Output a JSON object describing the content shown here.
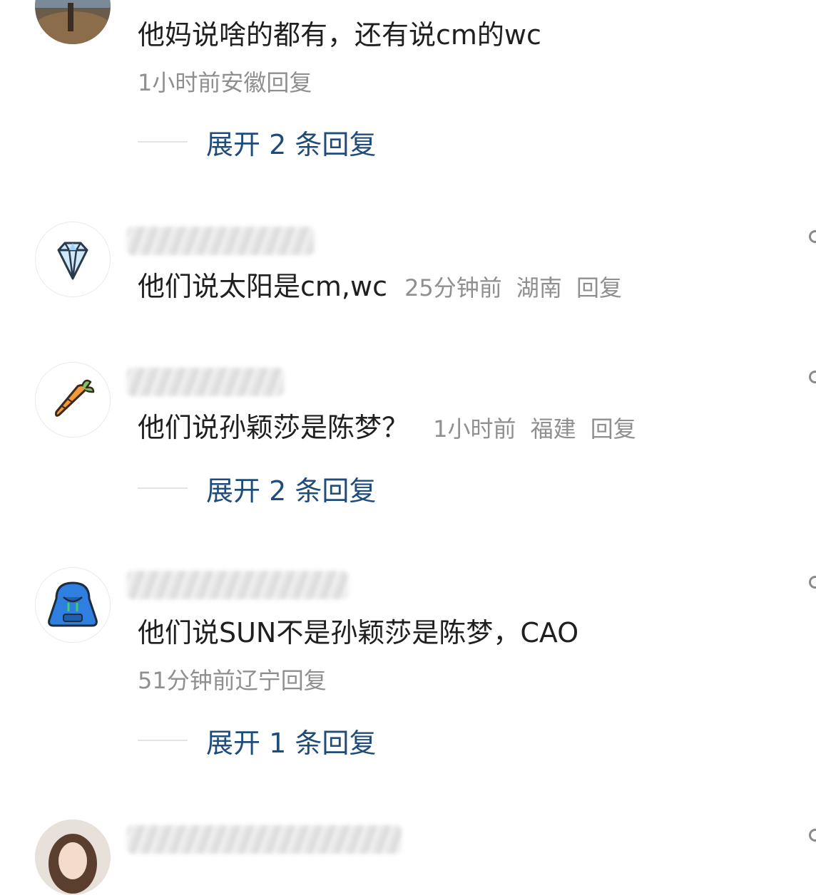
{
  "comments": [
    {
      "text": "他妈说啥的都有，还有说cm的wc",
      "time": "1小时前",
      "region": "安徽",
      "reply_label": "回复",
      "expand_label": "展开 2 条回复"
    },
    {
      "text": "他们说太阳是cm,wc",
      "time": "25分钟前",
      "region": "湖南",
      "reply_label": "回复"
    },
    {
      "text": "他们说孙颖莎是陈梦？",
      "time": "1小时前",
      "region": "福建",
      "reply_label": "回复",
      "expand_label": "展开 2 条回复"
    },
    {
      "text": "他们说SUN不是孙颖莎是陈梦，CAO",
      "time": "51分钟前",
      "region": "辽宁",
      "reply_label": "回复",
      "expand_label": "展开 1 条回复"
    }
  ],
  "icons": {
    "avatar_2": "diamond-icon",
    "avatar_3": "carrot-icon",
    "avatar_4": "hoodie-icon"
  },
  "colors": {
    "link": "#1f4c7a",
    "meta": "#8f8f8f",
    "text": "#1f1f1f"
  }
}
